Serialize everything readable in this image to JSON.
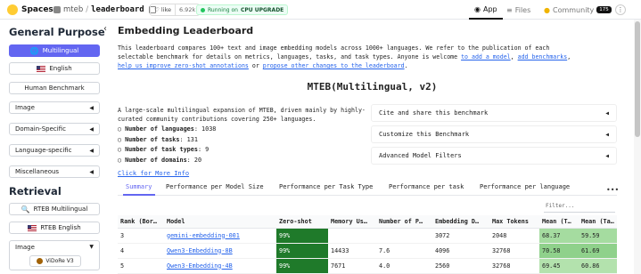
{
  "header": {
    "logo_label": "Spaces",
    "owner": "mteb",
    "separator": "/",
    "repo": "leaderboard",
    "like_label": "like",
    "like_count": "6.92k",
    "running_label": "Running on",
    "running_hw": "CPU UPGRADE",
    "tabs": [
      {
        "icon": "◉",
        "label": "App"
      },
      {
        "icon": "≡",
        "label": "Files"
      },
      {
        "icon": "●",
        "label": "Community"
      }
    ],
    "community_count": "175",
    "menu_label": "⋮"
  },
  "sidebar": {
    "heading_general": "General Purpose",
    "heading_retrieval": "Retrieval",
    "buttons": {
      "multilingual": "Multilingual",
      "english": "English",
      "human": "Human Benchmark",
      "rteb_multilingual": "RTEB Multilingual",
      "rteb_english": "RTEB English",
      "vidore": "ViDoRe V3"
    },
    "groups": {
      "image": "Image",
      "domain": "Domain-Specific",
      "language": "Language-specific",
      "misc": "Miscellaneous",
      "image2": "Image"
    },
    "collapsed_indicator": "◀",
    "expanded_indicator": "▼"
  },
  "main": {
    "title": "Embedding Leaderboard",
    "intro_1": "This leaderboard compares 100+ text and image embedding models across 1000+ languages. We refer to the publication of each",
    "intro_2": "selectable benchmark for details on metrics, languages, tasks, and task types. Anyone is welcome ",
    "link_add_model": "to add a model",
    "comma": ", ",
    "link_add_bench": "add benchmarks",
    "comma2": ",",
    "link_zero_shot": "help us improve zero-shot annotations",
    "or_text": " or ",
    "link_propose": "propose other changes to the leaderboard",
    "period": ".",
    "benchmark_title": "MTEB(Multilingual, v2)",
    "description": "A large-scale multilingual expansion of MTEB, driven mainly by highly-curated community contributions covering 250+ languages.",
    "stats": [
      {
        "label": "Number of languages",
        "value": "1038"
      },
      {
        "label": "Number of tasks",
        "value": "131"
      },
      {
        "label": "Number of task types",
        "value": "9"
      },
      {
        "label": "Number of domains",
        "value": "20"
      }
    ],
    "stat_bullet": "○",
    "stat_sep": ":",
    "more_info": "Click for More Info",
    "accordions": [
      "Cite and share this benchmark",
      "Customize this Benchmark",
      "Advanced Model Filters"
    ],
    "accordion_indicator": "◀",
    "tabs": [
      "Summary",
      "Performance per Model Size",
      "Performance per Task Type",
      "Performance per task",
      "Performance per language"
    ],
    "more_tabs": "•••",
    "filter_placeholder": "Filter...",
    "table": {
      "headers": [
        "Rank (Bor…",
        "Model",
        "Zero-shot",
        "Memory Us…",
        "Number of P…",
        "Embedding D…",
        "Max Tokens",
        "Mean (T…",
        "Mean (Ta…"
      ],
      "rows": [
        [
          "3",
          "gemini-embedding-001",
          "99%",
          "",
          "",
          "3072",
          "2048",
          "68.37",
          "59.59"
        ],
        [
          "4",
          "Qwen3-Embedding-8B",
          "99%",
          "14433",
          "7.6",
          "4096",
          "32768",
          "70.58",
          "61.69"
        ],
        [
          "5",
          "Qwen3-Embedding-4B",
          "99%",
          "7671",
          "4.0",
          "2560",
          "32768",
          "69.45",
          "60.86"
        ]
      ]
    }
  },
  "colors": {
    "accent": "#6366f1",
    "zero_shot_cell": "#1f7a2a",
    "link": "#2563eb"
  }
}
